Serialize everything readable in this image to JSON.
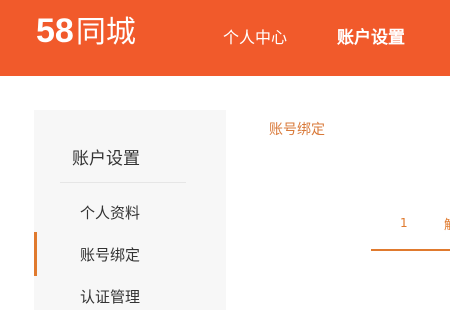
{
  "header": {
    "logo_number": "58",
    "logo_text": "同城",
    "nav": {
      "personal_center": "个人中心",
      "account_settings": "账户设置"
    },
    "bg_color": "#f15a2b"
  },
  "sidebar": {
    "title": "账户设置",
    "items": [
      {
        "label": "个人资料"
      },
      {
        "label": "账号绑定",
        "active": true
      },
      {
        "label": "认证管理"
      }
    ]
  },
  "main": {
    "section_title": "账号绑定",
    "steps": [
      {
        "number": "1"
      },
      {
        "label_partial": "解"
      }
    ]
  },
  "colors": {
    "accent": "#e07a2e"
  }
}
